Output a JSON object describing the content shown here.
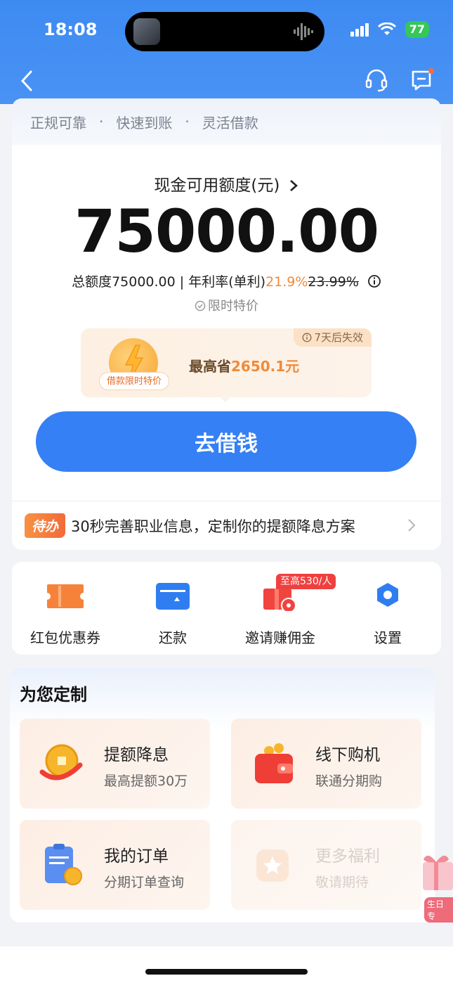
{
  "status_bar": {
    "time": "18:08",
    "battery": "77"
  },
  "header": {
    "back_icon": "chevron-left-icon",
    "service_icon": "headset-icon",
    "message_icon": "message-icon"
  },
  "main_card": {
    "taglines": [
      "正规可靠",
      "快速到账",
      "灵活借款"
    ],
    "separator": "·",
    "credit_label": "现金可用额度(元)",
    "credit_amount": "75000.00",
    "info": {
      "total_prefix": "总额度",
      "total_value": "75000.00",
      "divider": " | ",
      "rate_label": "年利率(单利)",
      "rate_value": "21.9%",
      "rate_original": "23.99%"
    },
    "limited_text": "限时特价",
    "promo": {
      "expire": "7天后失效",
      "tag": "借款限时特价",
      "save_prefix": "最高省",
      "save_amount": "2650.1元"
    },
    "borrow_button": "去借钱",
    "todo": {
      "badge": "待办",
      "text": "30秒完善职业信息，定制你的提额降息方案"
    }
  },
  "quick_actions": {
    "items": [
      {
        "label": "红包优惠券",
        "icon": "coupon-icon"
      },
      {
        "label": "还款",
        "icon": "repay-icon"
      },
      {
        "label": "邀请赚佣金",
        "icon": "gift-icon"
      },
      {
        "label": "设置",
        "icon": "settings-icon"
      }
    ],
    "invite_badge": "至高530/人"
  },
  "customized": {
    "title": "为您定制",
    "tiles": [
      {
        "title": "提额降息",
        "sub": "最高提额30万",
        "icon": "coin-arrow-icon"
      },
      {
        "title": "线下购机",
        "sub": "联通分期购",
        "icon": "wallet-icon"
      },
      {
        "title": "我的订单",
        "sub": "分期订单查询",
        "icon": "clipboard-icon"
      },
      {
        "title": "更多福利",
        "sub": "敬请期待",
        "icon": "star-icon"
      }
    ]
  },
  "floating": {
    "label": "生日专"
  },
  "colors": {
    "primary": "#3580f4",
    "header": "#3d8bf2",
    "accent_orange": "#f08a3a",
    "badge_red": "#ef4040"
  }
}
